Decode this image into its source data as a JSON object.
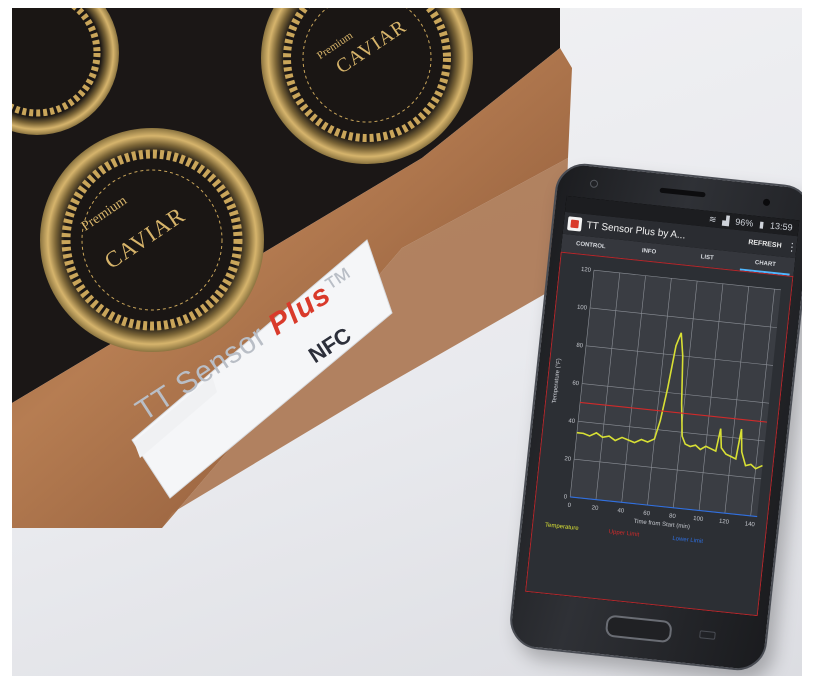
{
  "box": {
    "lid_premium": "Premium",
    "lid_name": "CAVIAR",
    "top_premium": "Premium",
    "top_name": "CAVIAR",
    "brand_prefix": "TT Sensor ",
    "brand_accent": "Plus",
    "brand_suffix": "™",
    "nfc": "NFC"
  },
  "phone": {
    "status": {
      "time": "13:59",
      "battery": "96%"
    },
    "app_title": "TT Sensor Plus by A...",
    "refresh_label": "REFRESH",
    "tabs": [
      {
        "label": "CONTROL",
        "active": false
      },
      {
        "label": "INFO",
        "active": false
      },
      {
        "label": "LIST",
        "active": false
      },
      {
        "label": "CHART",
        "active": true
      }
    ]
  },
  "chart_data": {
    "type": "line",
    "xlabel": "Time from Start (min)",
    "ylabel": "Temperature (°F)",
    "xlim": [
      0,
      145
    ],
    "ylim": [
      0,
      120
    ],
    "xticks": [
      0,
      20,
      40,
      60,
      80,
      100,
      120,
      140
    ],
    "yticks": [
      0,
      20,
      40,
      60,
      80,
      100,
      120
    ],
    "grid": true,
    "legend": "bottom",
    "series": [
      {
        "name": "Temperature",
        "color": "#d8e034",
        "x": [
          0,
          5,
          10,
          15,
          20,
          25,
          30,
          35,
          40,
          45,
          50,
          55,
          60,
          63,
          66,
          69,
          72,
          75,
          78,
          81,
          84,
          88,
          92,
          96,
          100,
          104,
          108,
          110,
          112,
          116,
          120,
          124,
          126,
          128,
          132,
          136,
          140,
          145
        ],
        "y": [
          34,
          34,
          33,
          35,
          33,
          34,
          32,
          34,
          33,
          32,
          34,
          33,
          35,
          45,
          62,
          85,
          92,
          80,
          55,
          38,
          34,
          33,
          34,
          32,
          34,
          33,
          32,
          44,
          34,
          31,
          30,
          29,
          45,
          33,
          26,
          27,
          25,
          27
        ]
      },
      {
        "name": "Upper Limit",
        "color": "#d02a2a",
        "x": [
          0,
          145
        ],
        "y": [
          50,
          50
        ]
      },
      {
        "name": "Lower Limit",
        "color": "#2f6fe0",
        "x": [
          0,
          145
        ],
        "y": [
          0,
          0
        ]
      }
    ]
  },
  "colors": {
    "wood": "#a8724a",
    "lid_black": "#1b1716",
    "gold": "#c9a55a",
    "tab_indicator": "#4fb7ff"
  }
}
